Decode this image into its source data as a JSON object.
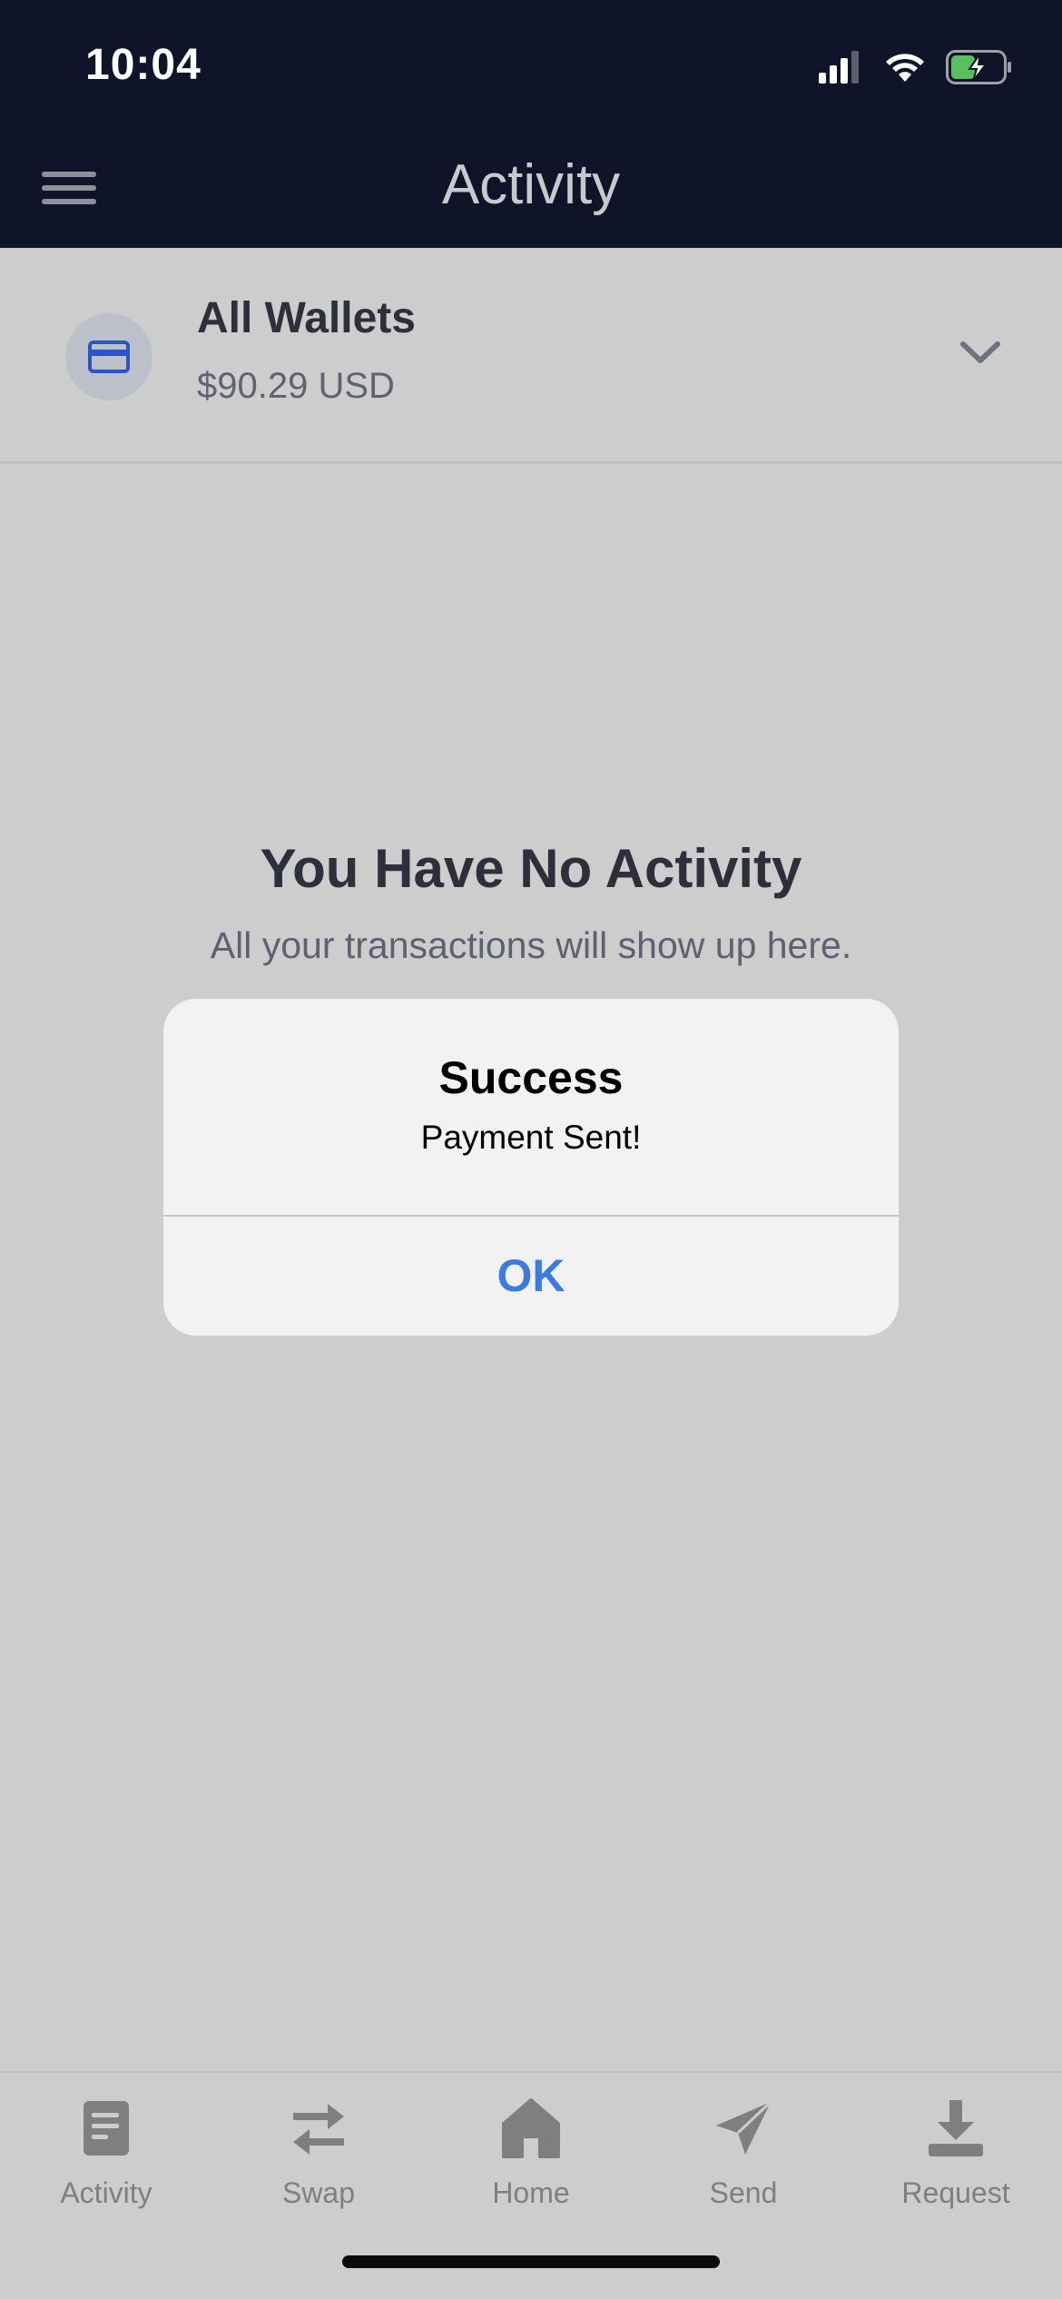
{
  "status_bar": {
    "time": "10:04"
  },
  "nav": {
    "title": "Activity",
    "menu_icon": "hamburger-menu-icon"
  },
  "wallet": {
    "name": "All Wallets",
    "balance": "$90.29 USD",
    "icon": "credit-card-icon",
    "accent_color": "#2a55c9"
  },
  "empty_state": {
    "title": "You Have No Activity",
    "subtitle": "All your transactions will show up here."
  },
  "dialog": {
    "title": "Success",
    "message": "Payment Sent!",
    "ok_label": "OK",
    "ok_color": "#3b7ce3"
  },
  "tabs": [
    {
      "label": "Activity",
      "icon": "document-icon"
    },
    {
      "label": "Swap",
      "icon": "swap-arrows-icon"
    },
    {
      "label": "Home",
      "icon": "home-icon"
    },
    {
      "label": "Send",
      "icon": "paper-plane-icon"
    },
    {
      "label": "Request",
      "icon": "download-tray-icon"
    }
  ]
}
